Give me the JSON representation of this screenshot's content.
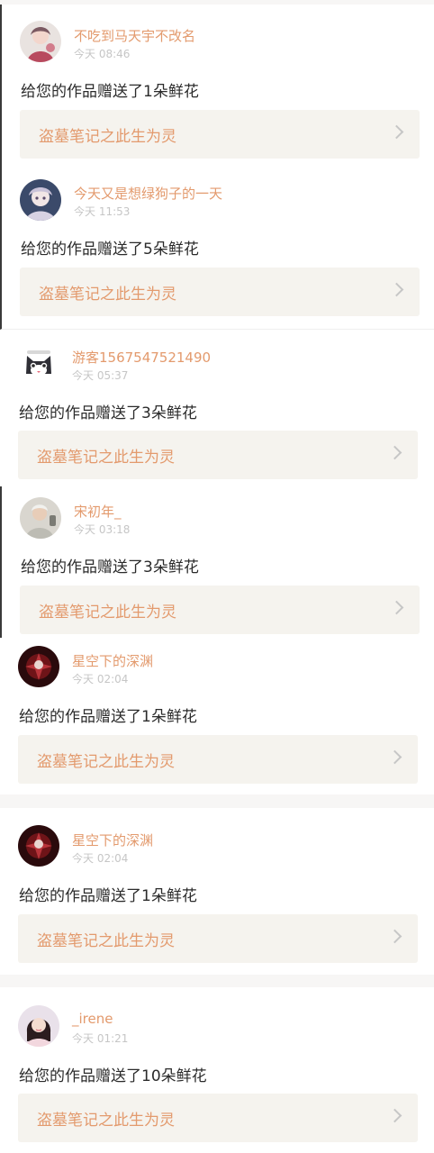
{
  "notifications": [
    {
      "username": "不吃到马天宇不改名",
      "time": "今天 08:46",
      "message": "给您的作品赠送了1朵鲜花",
      "work_title": "盗墓笔记之此生为灵",
      "avatar": "avatar-anime-girl-icon"
    },
    {
      "username": "今天又是想绿狗子的一天",
      "time": "今天 11:53",
      "message": "给您的作品赠送了5朵鲜花",
      "work_title": "盗墓笔记之此生为灵",
      "avatar": "avatar-anime-character-icon"
    },
    {
      "username": "游客1567547521490",
      "time": "今天 05:37",
      "message": "给您的作品赠送了3朵鲜花",
      "work_title": "盗墓笔记之此生为灵",
      "avatar": "avatar-cat-icon"
    },
    {
      "username": "宋初年_",
      "time": "今天 03:18",
      "message": "给您的作品赠送了3朵鲜花",
      "work_title": "盗墓笔记之此生为灵",
      "avatar": "avatar-person-photo-icon"
    },
    {
      "username": "星空下的深渊",
      "time": "今天 02:04",
      "message": "给您的作品赠送了1朵鲜花",
      "work_title": "盗墓笔记之此生为灵",
      "avatar": "avatar-dark-red-icon"
    },
    {
      "username": "星空下的深渊",
      "time": "今天 02:04",
      "message": "给您的作品赠送了1朵鲜花",
      "work_title": "盗墓笔记之此生为灵",
      "avatar": "avatar-dark-red-icon"
    },
    {
      "username": "_irene",
      "time": "今天 01:21",
      "message": "给您的作品赠送了10朵鲜花",
      "work_title": "盗墓笔记之此生为灵",
      "avatar": "avatar-woman-photo-icon"
    }
  ],
  "colors": {
    "accent": "#e39a6d",
    "muted": "#c6c6c6",
    "text": "#2b2b2b",
    "work_bg": "#f5f3ee",
    "page_bg": "#f7f6f5"
  }
}
